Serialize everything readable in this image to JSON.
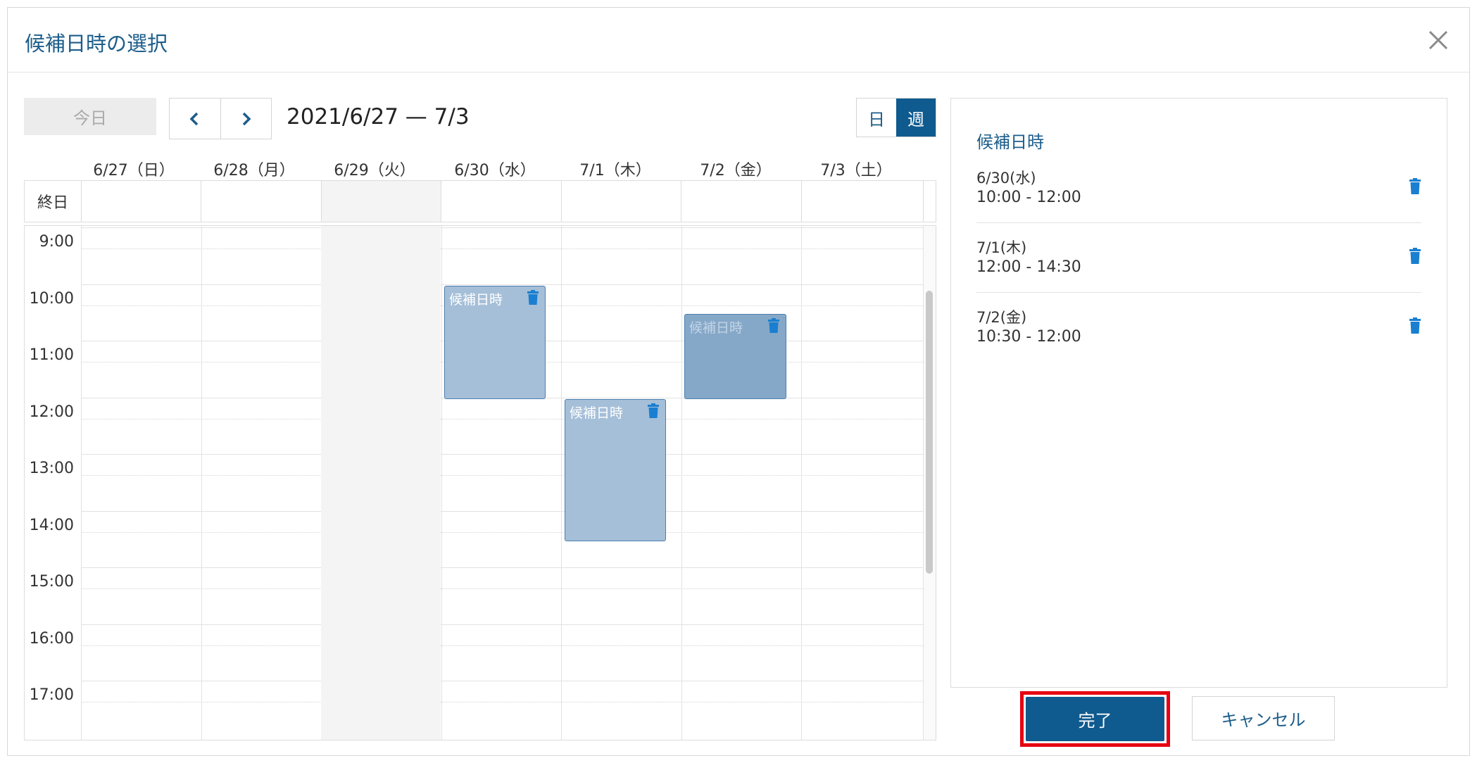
{
  "dialog": {
    "title": "候補日時の選択"
  },
  "toolbar": {
    "today_label": "今日",
    "date_range": "2021/6/27 — 7/3",
    "view_day_label": "日",
    "view_week_label": "週",
    "active_view": "週"
  },
  "calendar": {
    "days": [
      "6/27（日）",
      "6/28（月）",
      "6/29（火）",
      "6/30（水）",
      "7/1（木）",
      "7/2（金）",
      "7/3（土）"
    ],
    "allday_label": "終日",
    "hours": [
      "9:00",
      "10:00",
      "11:00",
      "12:00",
      "13:00",
      "14:00",
      "15:00",
      "16:00",
      "17:00"
    ],
    "events": [
      {
        "label": "候補日時",
        "day": "6/30（水）",
        "start": "10:00",
        "end": "12:00"
      },
      {
        "label": "候補日時",
        "day": "7/1（木）",
        "start": "12:00",
        "end": "14:30"
      },
      {
        "label": "候補日時",
        "day": "7/2（金）",
        "start": "10:30",
        "end": "12:00"
      }
    ]
  },
  "panel": {
    "title": "候補日時",
    "candidates": [
      {
        "date": "6/30(水)",
        "time": "10:00 - 12:00"
      },
      {
        "date": "7/1(木)",
        "time": "12:00 - 14:30"
      },
      {
        "date": "7/2(金)",
        "time": "10:30 - 12:00"
      }
    ]
  },
  "footer": {
    "done_label": "完了",
    "cancel_label": "キャンセル"
  },
  "colors": {
    "primary": "#0f5a8e",
    "event_fill": "#a5bfd8",
    "highlight": "#e60012"
  }
}
